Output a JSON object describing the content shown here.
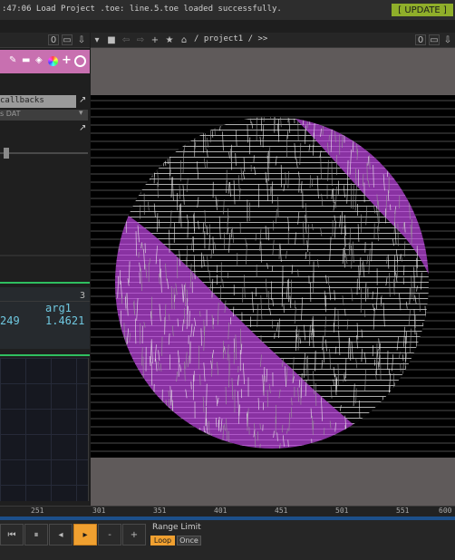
{
  "status": {
    "message": ":47:06 Load Project .toe: line.5.toe loaded successfully.",
    "update_label": "[ UPDATE ]"
  },
  "left_toolbar": {
    "counter": "0"
  },
  "pane": {
    "path": "/ project1 / >>",
    "counter_left": "0",
    "counter_right": "0"
  },
  "panel": {
    "callbacks_label": "callbacks",
    "dat_label": "s DAT",
    "table_col": "3",
    "table_header": "arg1",
    "value_left": "249",
    "value_right": "1.4621"
  },
  "timeline": {
    "ticks": [
      "251",
      "301",
      "351",
      "401",
      "451",
      "501",
      "551",
      "600"
    ]
  },
  "transport": {
    "range_limit_label": "Range Limit",
    "loop_label": "Loop",
    "once_label": "Once"
  },
  "colors": {
    "accent_orange": "#f0a030",
    "magenta": "#b040d0",
    "update_green": "#8fae2a",
    "panel_pink": "#c870b0",
    "tab_green": "#2fbf60"
  }
}
